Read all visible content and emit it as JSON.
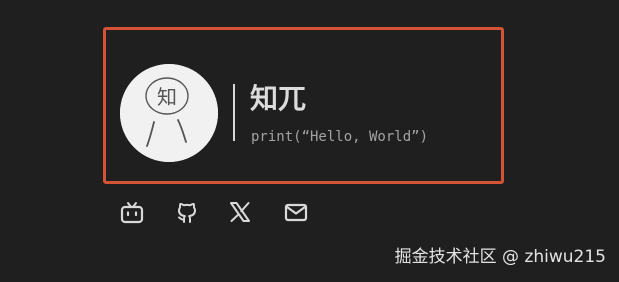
{
  "profile": {
    "avatar_glyph": "知",
    "name": "知兀",
    "tagline": "print(“Hello, World”)"
  },
  "social_links": [
    {
      "icon": "bilibili-icon"
    },
    {
      "icon": "github-icon"
    },
    {
      "icon": "x-twitter-icon"
    },
    {
      "icon": "mail-icon"
    }
  ],
  "watermark": "掘金技术社区 @ zhiwu215",
  "colors": {
    "background": "#1f1f1f",
    "highlight_border": "#d45235",
    "name_text": "#dcdcdc",
    "tagline_text": "#a3a3a3",
    "icon": "#d9d9d9"
  }
}
